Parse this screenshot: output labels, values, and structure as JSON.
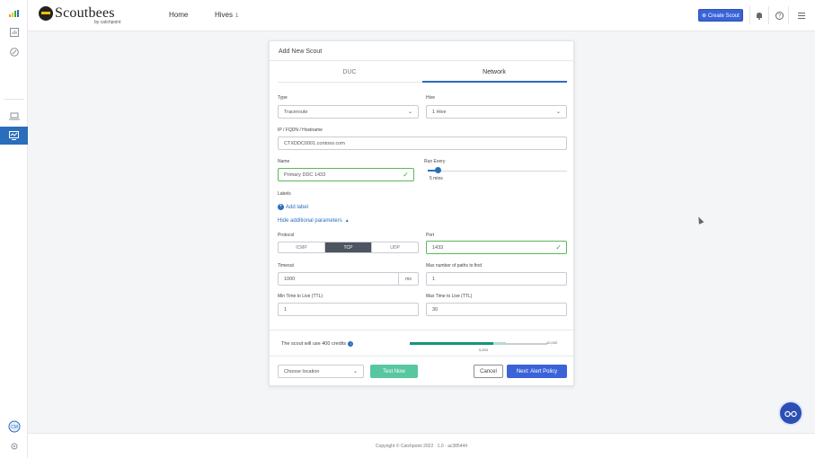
{
  "header": {
    "logo_name": "Scoutbees",
    "logo_by": "by catchpoint",
    "nav_home": "Home",
    "nav_hives": "Hives",
    "nav_hives_badge": "1",
    "create_scout": "⊕ Create Scout"
  },
  "modal": {
    "title": "Add New Scout",
    "tabs": [
      {
        "label": "DUC",
        "active": false
      },
      {
        "label": "Network",
        "active": true
      }
    ],
    "type": {
      "label": "Type",
      "value": "Traceroute"
    },
    "hive": {
      "label": "Hive",
      "value": "1 Hive"
    },
    "ip": {
      "label": "IP / FQDN / Hostname",
      "value": "CTXDDC0001.contoso.com"
    },
    "name": {
      "label": "Name",
      "value": "Primary DDC 1433"
    },
    "run_every": {
      "label": "Run Every",
      "value": "5 mins",
      "fraction": 0.07
    },
    "labels": {
      "label": "Labels",
      "add": "Add label"
    },
    "hide_params": "Hide additional parameters",
    "protocol": {
      "label": "Protocol",
      "options": [
        {
          "label": "ICMP",
          "active": false
        },
        {
          "label": "TCP",
          "active": true
        },
        {
          "label": "UDP",
          "active": false
        }
      ]
    },
    "port": {
      "label": "Port",
      "value": "1433"
    },
    "timeout": {
      "label": "Timeout",
      "value": "1000",
      "unit": "ms"
    },
    "max_paths": {
      "label": "Max number of paths to find",
      "value": "1"
    },
    "min_ttl": {
      "label": "Min Time to Live (TTL)",
      "value": "1"
    },
    "max_ttl": {
      "label": "Max Time to Live (TTL)",
      "value": "30"
    },
    "credits": {
      "text": "The scout will use 400 credits",
      "max_label": "10,000",
      "min_label": "5,833",
      "used_fraction": 0.61,
      "available_fraction": 0.7
    },
    "location": {
      "value": "Choose location"
    },
    "buttons": {
      "test": "Test Now",
      "cancel": "Cancel",
      "next": "Next: Alert Policy"
    }
  },
  "footer": {
    "text": "Copyright © Catchpoint 2022 · 1.0 · ac385444"
  },
  "colors": {
    "primary": "#2a6ebb",
    "button": "#3a63d8",
    "success": "#5cb85c",
    "test": "#57c7a0",
    "credits": "#16957a"
  }
}
